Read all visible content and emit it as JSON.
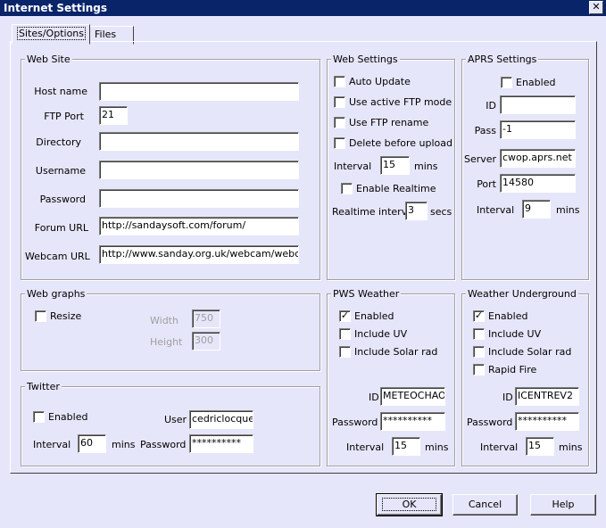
{
  "window": {
    "title": "Internet Settings",
    "close_glyph": "✕"
  },
  "tabs": [
    "Sites/Options",
    "Files"
  ],
  "website": {
    "legend": "Web Site",
    "host_label": "Host name",
    "host_value": "",
    "ftp_port_label": "FTP Port",
    "ftp_port_value": "21",
    "directory_label": "Directory",
    "directory_value": "",
    "username_label": "Username",
    "username_value": "",
    "password_label": "Password",
    "password_value": "",
    "forum_label": "Forum URL",
    "forum_value": "http://sandaysoft.com/forum/",
    "webcam_label": "Webcam URL",
    "webcam_value": "http://www.sanday.org.uk/webcam/webcam"
  },
  "websettings": {
    "legend": "Web Settings",
    "auto_update": "Auto Update",
    "active_ftp": "Use active FTP mode",
    "ftp_rename": "Use FTP rename",
    "delete_before": "Delete before upload",
    "interval_label": "Interval",
    "interval_value": "15",
    "interval_unit": "mins",
    "enable_realtime": "Enable Realtime",
    "rt_interval_label": "Realtime interval",
    "rt_interval_value": "3",
    "rt_interval_unit": "secs"
  },
  "aprs": {
    "legend": "APRS Settings",
    "enabled": "Enabled",
    "id_label": "ID",
    "id_value": "",
    "pass_label": "Pass",
    "pass_value": "-1",
    "server_label": "Server",
    "server_value": "cwop.aprs.net",
    "port_label": "Port",
    "port_value": "14580",
    "interval_label": "Interval",
    "interval_value": "9",
    "interval_unit": "mins"
  },
  "webgraphs": {
    "legend": "Web graphs",
    "resize": "Resize",
    "width_label": "Width",
    "width_value": "750",
    "height_label": "Height",
    "height_value": "300"
  },
  "twitter": {
    "legend": "Twitter",
    "enabled": "Enabled",
    "user_label": "User",
    "user_value": "cedriclocquen",
    "interval_label": "Interval",
    "interval_value": "60",
    "interval_unit": "mins",
    "password_label": "Password",
    "password_value": "**********"
  },
  "pws": {
    "legend": "PWS Weather",
    "enabled": "Enabled",
    "enabled_checked": "✓",
    "include_uv": "Include UV",
    "include_solar": "Include Solar rad",
    "id_label": "ID",
    "id_value": "METEOCHAON",
    "password_label": "Password",
    "password_value": "**********",
    "interval_label": "Interval",
    "interval_value": "15",
    "interval_unit": "mins"
  },
  "wu": {
    "legend": "Weather Underground",
    "enabled": "Enabled",
    "enabled_checked": "✓",
    "include_uv": "Include UV",
    "include_solar": "Include Solar rad",
    "rapid_fire": "Rapid Fire",
    "id_label": "ID",
    "id_value": "ICENTREV2",
    "password_label": "Password",
    "password_value": "**********",
    "interval_label": "Interval",
    "interval_value": "15",
    "interval_unit": "mins"
  },
  "buttons": {
    "ok": "OK",
    "cancel": "Cancel",
    "help": "Help"
  }
}
